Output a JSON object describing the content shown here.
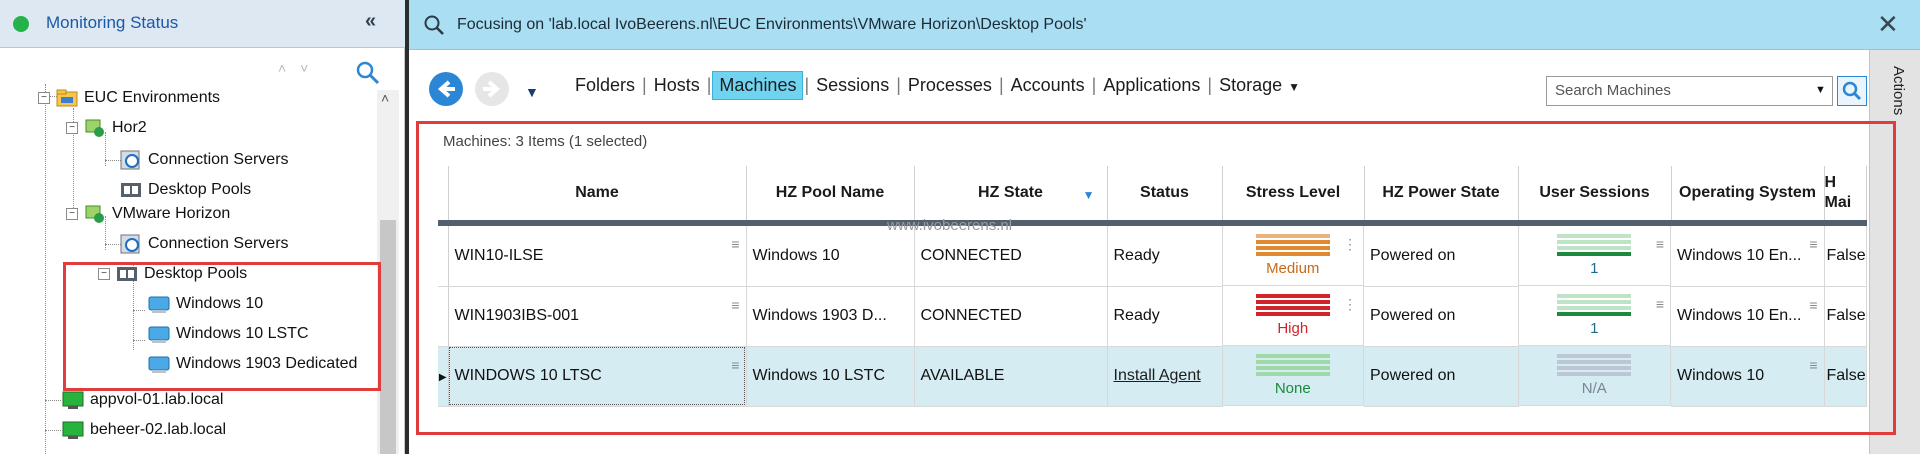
{
  "left_panel": {
    "status_label": "Monitoring Status",
    "collapse_glyph": "«",
    "tree": {
      "euc_environments": "EUC Environments",
      "hor2": "Hor2",
      "hor2_connection_servers": "Connection Servers",
      "hor2_desktop_pools": "Desktop Pools",
      "vmware_horizon": "VMware Horizon",
      "vh_connection_servers": "Connection Servers",
      "vh_desktop_pools": "Desktop Pools",
      "pool_1": "Windows 10",
      "pool_2": "Windows 10 LSTC",
      "pool_3": "Windows 1903 Dedicated",
      "machine_1": "appvol-01.lab.local",
      "machine_2": "beheer-02.lab.local"
    }
  },
  "breadcrumb": {
    "text": "Focusing on 'lab.local IvoBeerens.nl\\EUC Environments\\VMware Horizon\\Desktop Pools'"
  },
  "toolbar": {
    "tabs": [
      "Folders",
      "Hosts",
      "Machines",
      "Sessions",
      "Processes",
      "Accounts",
      "Applications",
      "Storage"
    ],
    "active_tab": "Machines",
    "search_placeholder": "Search Machines",
    "actions_label": "Actions"
  },
  "grid": {
    "items_label": "Machines: 3 Items (1 selected)",
    "watermark": "www.ivobeerens.nl",
    "columns": [
      "Name",
      "HZ Pool Name",
      "HZ State",
      "Status",
      "Stress Level",
      "HZ Power State",
      "User Sessions",
      "Operating System",
      "H Mai"
    ],
    "rows": [
      {
        "name": "WIN10-ILSE",
        "pool": "Windows 10",
        "state": "CONNECTED",
        "status": "Ready",
        "stress": "Medium",
        "power": "Powered on",
        "sessions": "1",
        "os": "Windows 10 En...",
        "maint": "False"
      },
      {
        "name": "WIN1903IBS-001",
        "pool": "Windows 1903 D...",
        "state": "CONNECTED",
        "status": "Ready",
        "stress": "High",
        "power": "Powered on",
        "sessions": "1",
        "os": "Windows 10 En...",
        "maint": "False"
      },
      {
        "name": "WINDOWS 10 LTSC",
        "pool": "Windows 10 LSTC",
        "state": "AVAILABLE",
        "status": "Install Agent",
        "stress": "None",
        "power": "Powered on",
        "sessions": "N/A",
        "os": "Windows 10",
        "maint": "False"
      }
    ]
  },
  "colors": {
    "accent": "#2c86d6",
    "breadcrumb_bg": "#a9def3",
    "highlight_red": "#e03c3c",
    "stress_medium": "#e0892e",
    "stress_high": "#d2232a",
    "stress_none": "#9fd9a8",
    "sessions_green": "#1c8a3c"
  }
}
